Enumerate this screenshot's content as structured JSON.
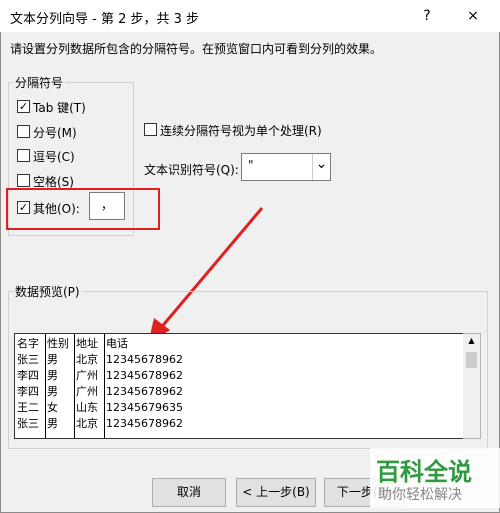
{
  "window": {
    "title": "文本分列向导 - 第 2 步，共 3 步",
    "help_label": "?",
    "close_label": "×"
  },
  "description": "请设置分列数据所包含的分隔符号。在预览窗口内可看到分列的效果。",
  "delimiters": {
    "group_label": "分隔符号",
    "tab": {
      "label": "Tab 键(T)",
      "checked": true,
      "check_glyph": "✓"
    },
    "semicolon": {
      "label": "分号(M)",
      "checked": false
    },
    "comma": {
      "label": "逗号(C)",
      "checked": false
    },
    "space": {
      "label": "空格(S)",
      "checked": false
    },
    "other": {
      "label": "其他(O):",
      "checked": true,
      "check_glyph": "✓",
      "value": "，"
    }
  },
  "consecutive": {
    "label": "连续分隔符号视为单个处理(R)",
    "checked": false
  },
  "text_qualifier": {
    "label": "文本识别符号(Q):",
    "value": "\"",
    "arrow": "⌄"
  },
  "preview": {
    "group_label": "数据预览(P)",
    "rows": [
      [
        "名字",
        "性别",
        "地址",
        "电话"
      ],
      [
        "张三",
        "男",
        "北京",
        "12345678962"
      ],
      [
        "李四",
        "男",
        "广州",
        "12345678962"
      ],
      [
        "李四",
        "男",
        "广州",
        "12345678962"
      ],
      [
        "王二",
        "女",
        "山东",
        "12345679635"
      ],
      [
        "张三",
        "男",
        "北京",
        "12345678962"
      ]
    ]
  },
  "buttons": {
    "cancel": "取消",
    "back": "< 上一步(B)",
    "next": "下一步(N)"
  },
  "watermark": {
    "line1": "百科全说",
    "line2": "助你轻松解决"
  },
  "colors": {
    "highlight": "#e02020",
    "watermark_green": "#2f9a3f"
  }
}
